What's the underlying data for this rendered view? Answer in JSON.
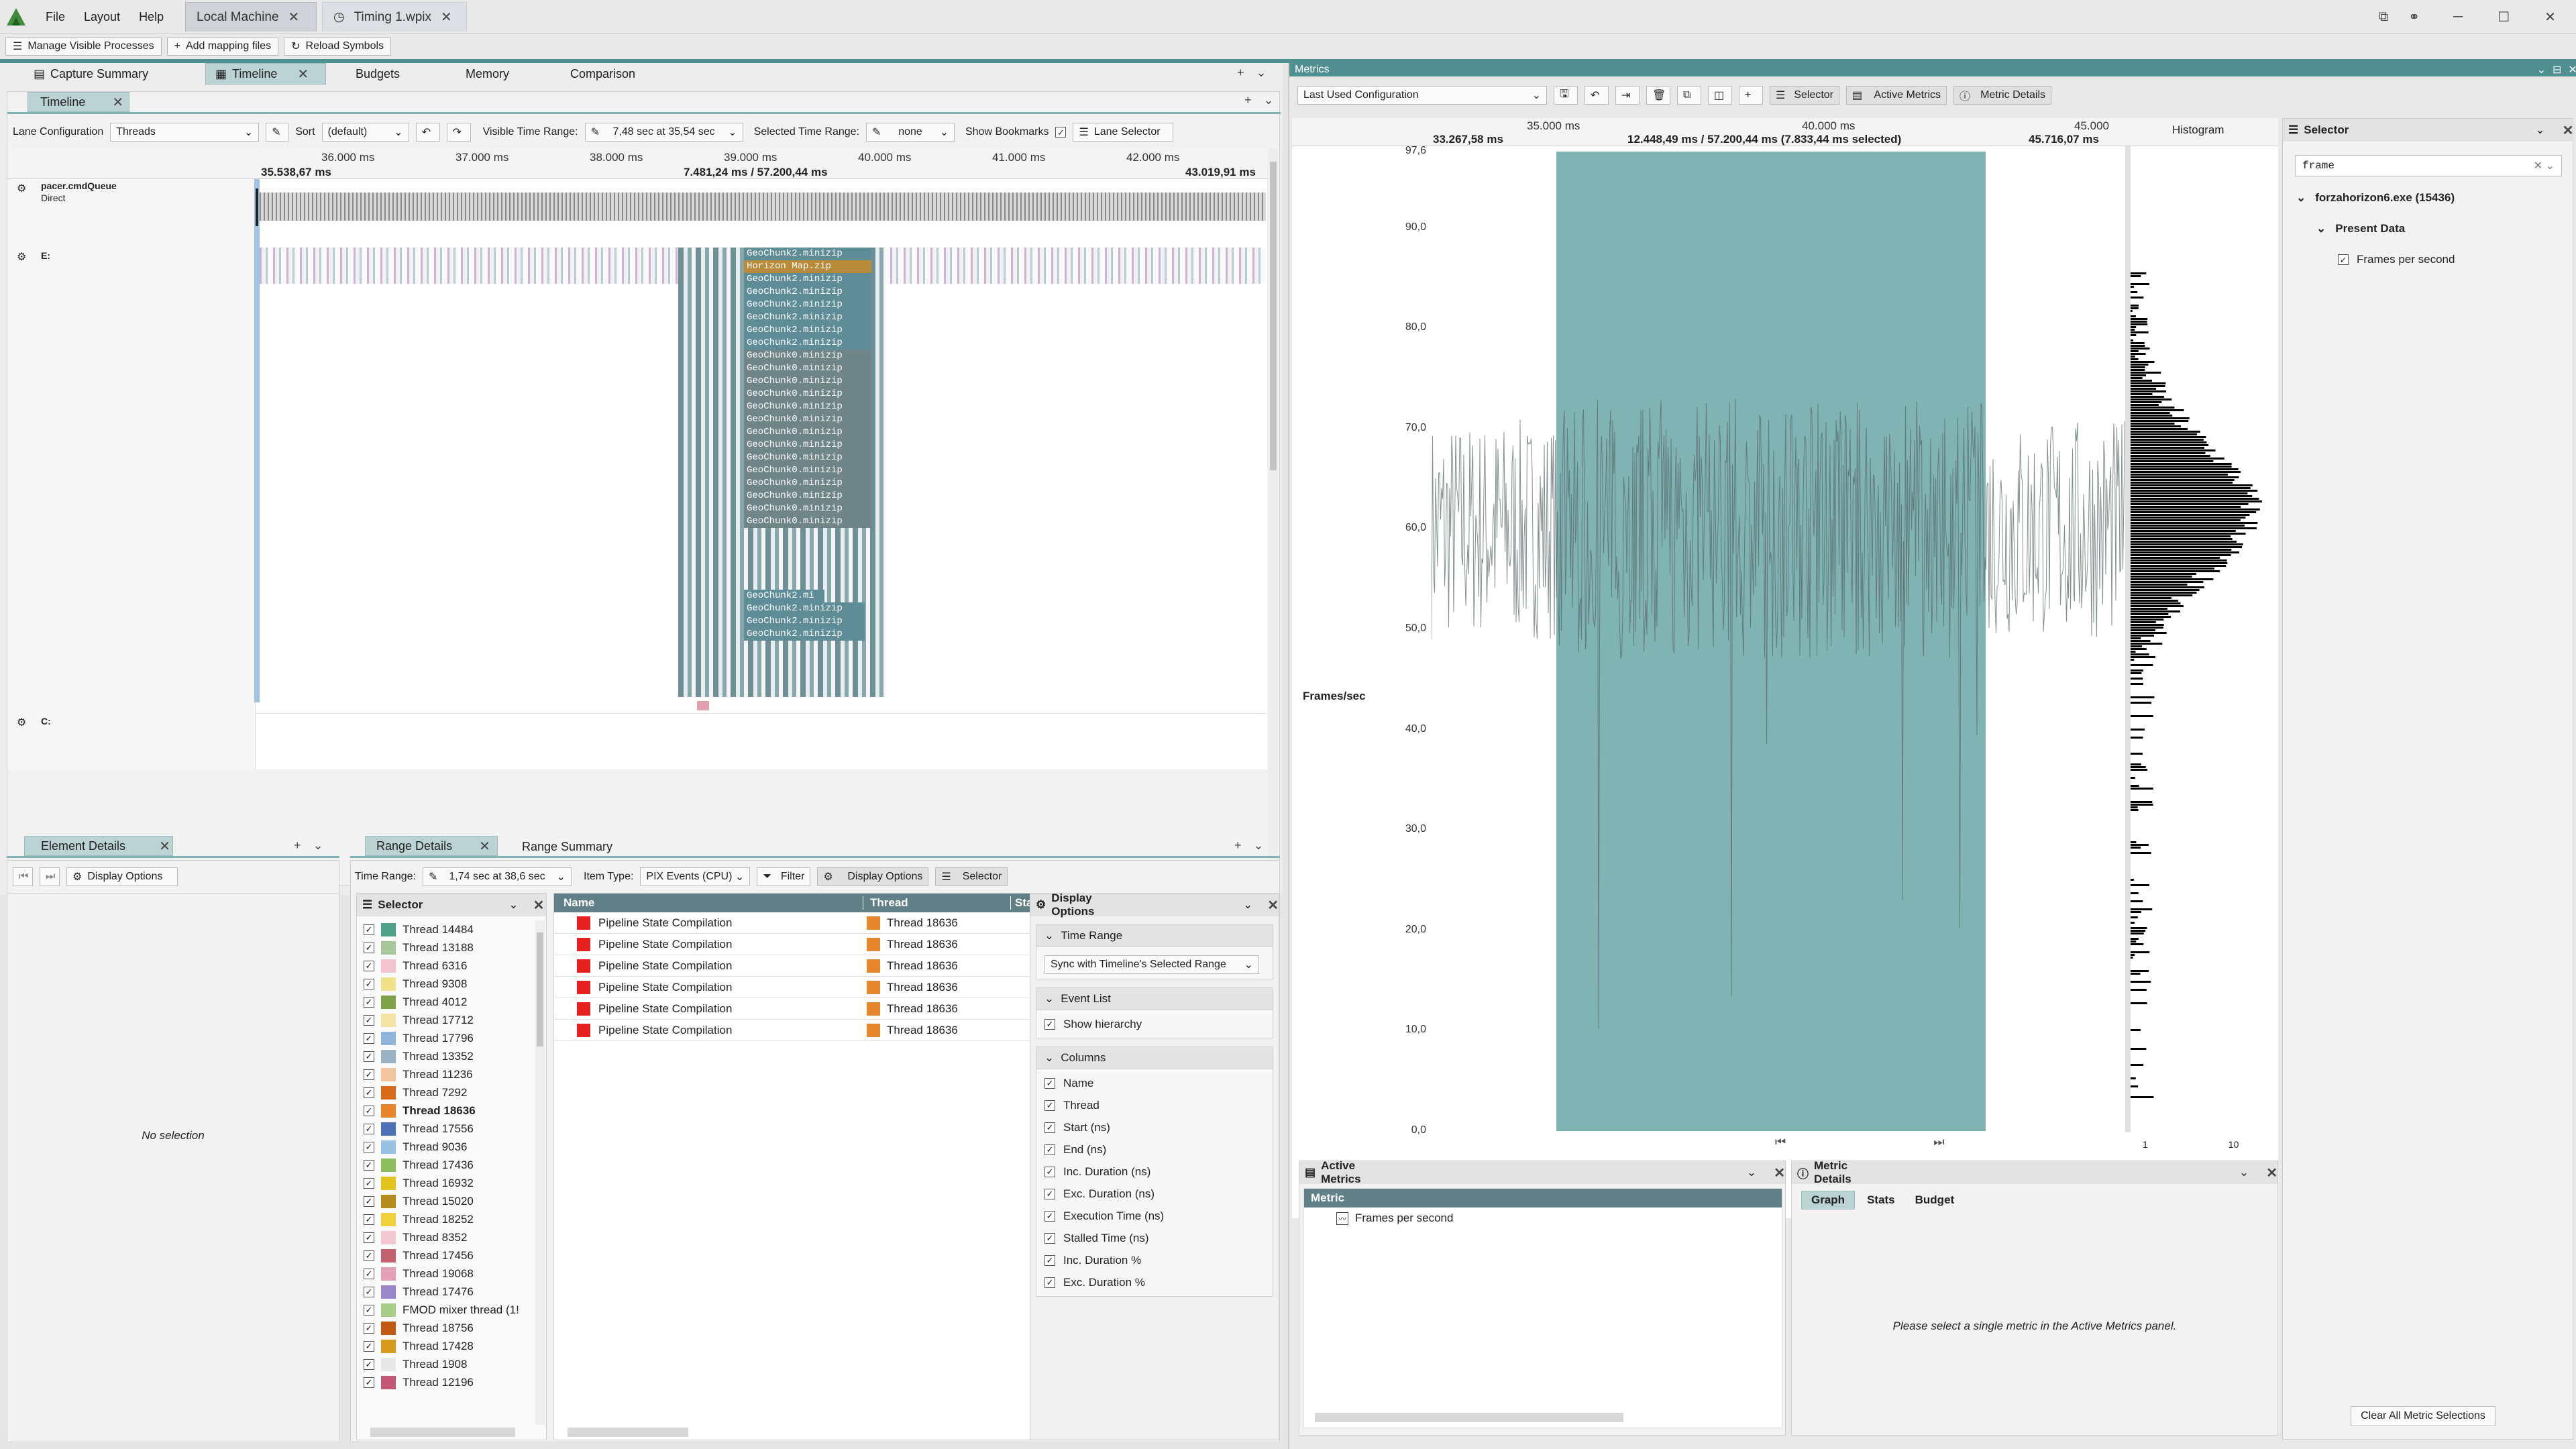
{
  "titlebar": {
    "menus": [
      "File",
      "Layout",
      "Help"
    ],
    "tabs": [
      {
        "label": "Local Machine",
        "active": true
      },
      {
        "label": "Timing 1.wpix",
        "active": false
      }
    ],
    "window_buttons": [
      "popout-icon",
      "link-icon",
      "minimize-icon",
      "maximize-icon",
      "restore-icon",
      "close-icon"
    ]
  },
  "actionbar": {
    "manage": "Manage Visible Processes",
    "add_mapping": "Add mapping files",
    "reload": "Reload Symbols"
  },
  "left_tabs": [
    "Capture Summary",
    "Timeline",
    "Budgets",
    "Memory",
    "Comparison"
  ],
  "timeline": {
    "tab": "Timeline",
    "lane_config_label": "Lane Configuration",
    "lane_config_value": "Threads",
    "sort_label": "Sort",
    "sort_value": "(default)",
    "visible_range_label": "Visible Time Range:",
    "visible_range_value": "7,48 sec at 35,54 sec",
    "selected_range_label": "Selected Time Range:",
    "selected_range_value": "none",
    "show_bookmarks": "Show Bookmarks",
    "lane_selector": "Lane Selector",
    "ticks": [
      "36.000 ms",
      "37.000 ms",
      "38.000 ms",
      "39.000 ms",
      "40.000 ms",
      "41.000 ms",
      "42.000 ms"
    ],
    "left_time": "35.538,67 ms",
    "mid_time": "7.481,24 ms / 57.200,44 ms",
    "right_time": "43.019,91 ms",
    "lanes": [
      {
        "name": "pacer.cmdQueue",
        "sub": "Direct"
      },
      {
        "name": "E:",
        "sub": ""
      },
      {
        "name": "C:",
        "sub": ""
      }
    ],
    "chunks": [
      "GeoChunk2.minizip",
      "Horizon Map.zip",
      "GeoChunk2.minizip",
      "GeoChunk2.minizip",
      "GeoChunk2.minizip",
      "GeoChunk2.minizip",
      "GeoChunk2.minizip",
      "GeoChunk2.minizip",
      "GeoChunk0.minizip",
      "GeoChunk0.minizip",
      "GeoChunk0.minizip",
      "GeoChunk0.minizip",
      "GeoChunk0.minizip",
      "GeoChunk0.minizip",
      "GeoChunk0.minizip",
      "GeoChunk0.minizip",
      "GeoChunk0.minizip",
      "GeoChunk0.minizip",
      "GeoChunk0.minizip",
      "GeoChunk0.minizip",
      "GeoChunk0.minizip",
      "GeoChunk0.minizip"
    ],
    "chunks_bottom": [
      "GeoChunk2.mi",
      "GeoChunk2.minizip",
      "GeoChunk2.minizip",
      "GeoChunk2.minizip"
    ]
  },
  "element_details": {
    "tab": "Element Details",
    "display_options": "Display Options",
    "empty": "No selection"
  },
  "range": {
    "tabs": [
      "Range Details",
      "Range Summary"
    ],
    "time_range_label": "Time Range:",
    "time_range_value": "1,74 sec at 38,6 sec",
    "item_type_label": "Item Type:",
    "item_type_value": "PIX Events (CPU)",
    "filter": "Filter",
    "display_options": "Display Options",
    "selector": "Selector",
    "selector_title": "Selector",
    "threads": [
      {
        "name": "Thread 14484",
        "color": "#4fa089"
      },
      {
        "name": "Thread 13188",
        "color": "#a8c79a"
      },
      {
        "name": "Thread 6316",
        "color": "#f3c6cf"
      },
      {
        "name": "Thread 9308",
        "color": "#f1e28a"
      },
      {
        "name": "Thread 4012",
        "color": "#7fa24a"
      },
      {
        "name": "Thread 17712",
        "color": "#f4e4a4"
      },
      {
        "name": "Thread 17796",
        "color": "#8fb6da"
      },
      {
        "name": "Thread 13352",
        "color": "#9ab3c4"
      },
      {
        "name": "Thread 11236",
        "color": "#f3c59c"
      },
      {
        "name": "Thread 7292",
        "color": "#d66a18"
      },
      {
        "name": "Thread 18636",
        "color": "#e8862c",
        "bold": true
      },
      {
        "name": "Thread 17556",
        "color": "#4d72b8"
      },
      {
        "name": "Thread 9036",
        "color": "#9bc1e0"
      },
      {
        "name": "Thread 17436",
        "color": "#8cbe5e"
      },
      {
        "name": "Thread 16932",
        "color": "#e2c41c"
      },
      {
        "name": "Thread 15020",
        "color": "#b58c1c"
      },
      {
        "name": "Thread 18252",
        "color": "#f1d23c"
      },
      {
        "name": "Thread 8352",
        "color": "#f4c8d2"
      },
      {
        "name": "Thread 17456",
        "color": "#c46070"
      },
      {
        "name": "Thread 19068",
        "color": "#e3a0b8"
      },
      {
        "name": "Thread 17476",
        "color": "#9a86c8"
      },
      {
        "name": "FMOD mixer thread (1!",
        "color": "#a8cf88"
      },
      {
        "name": "Thread 18756",
        "color": "#c25a14"
      },
      {
        "name": "Thread 17428",
        "color": "#d79a1c"
      },
      {
        "name": "Thread 1908",
        "color": "#e8e8e8"
      },
      {
        "name": "Thread 12196",
        "color": "#c45872"
      }
    ],
    "columns": [
      "Name",
      "Thread",
      "Sta"
    ],
    "rows": [
      {
        "name": "Pipeline State Compilation",
        "thread": "Thread 18636"
      },
      {
        "name": "Pipeline State Compilation",
        "thread": "Thread 18636"
      },
      {
        "name": "Pipeline State Compilation",
        "thread": "Thread 18636"
      },
      {
        "name": "Pipeline State Compilation",
        "thread": "Thread 18636"
      },
      {
        "name": "Pipeline State Compilation",
        "thread": "Thread 18636"
      },
      {
        "name": "Pipeline State Compilation",
        "thread": "Thread 18636"
      }
    ],
    "display_panel": {
      "title": "Display Options",
      "time_range_section": "Time Range",
      "time_range_value": "Sync with Timeline's Selected Range",
      "event_list_section": "Event List",
      "show_hierarchy": "Show hierarchy",
      "columns_section": "Columns",
      "columns": [
        "Name",
        "Thread",
        "Start (ns)",
        "End (ns)",
        "Inc. Duration (ns)",
        "Exc. Duration (ns)",
        "Execution Time (ns)",
        "Stalled Time (ns)",
        "Inc. Duration %",
        "Exc. Duration %"
      ]
    }
  },
  "metrics": {
    "title": "Metrics",
    "config_value": "Last Used Configuration",
    "selector_btn": "Selector",
    "active_metrics_btn": "Active Metrics",
    "metric_details_btn": "Metric Details",
    "ticks": [
      "35.000 ms",
      "40.000 ms",
      "45.000"
    ],
    "left_time": "33.267,58 ms",
    "mid_time": "12.448,49 ms / 57.200,44 ms (7.833,44 ms selected)",
    "right_time": "45.716,07 ms",
    "histogram_label": "Histogram",
    "histogram_ticks": [
      "1",
      "10"
    ],
    "y_axis_label": "Frames/sec",
    "y_ticks": [
      "97,6",
      "90,0",
      "80,0",
      "70,0",
      "60,0",
      "50,0",
      "40,0",
      "30,0",
      "20,0",
      "10,0",
      "0,0"
    ],
    "selector_panel": {
      "title": "Selector",
      "search_value": "frame",
      "process": "forzahorizon6.exe (15436)",
      "category": "Present Data",
      "metric": "Frames per second"
    },
    "active_metrics": {
      "title": "Active Metrics",
      "column": "Metric",
      "item": "Frames per second"
    },
    "metric_details": {
      "title": "Metric Details",
      "tabs": [
        "Graph",
        "Stats",
        "Budget"
      ],
      "empty": "Please select a single metric in the Active Metrics panel."
    },
    "clear_all": "Clear All Metric Selections"
  },
  "colors": {
    "accent": "#4f8f8f",
    "selection": "#7fb3b4",
    "event_red": "#e62020",
    "thread_orange": "#e8862c"
  }
}
